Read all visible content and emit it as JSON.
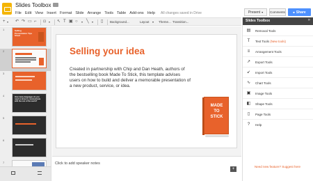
{
  "app": {
    "title": "Slides Toolbox",
    "save_status": "All changes saved in Drive",
    "menu": [
      "File",
      "Edit",
      "View",
      "Insert",
      "Format",
      "Slide",
      "Arrange",
      "Tools",
      "Table",
      "Add-ons",
      "Help"
    ]
  },
  "header_buttons": {
    "present": "Present",
    "comments": "Comments",
    "share": "Share"
  },
  "toolbar": {
    "background": "Background...",
    "layout": "Layout",
    "theme": "Theme...",
    "transition": "Transition..."
  },
  "thumbnails": [
    {
      "num": "1",
      "text": "Selling Presentation Tips Sheet",
      "style": "orange"
    },
    {
      "num": "2",
      "text": "",
      "style": "light"
    },
    {
      "num": "3",
      "text": "",
      "style": "orange"
    },
    {
      "num": "4",
      "text": "How many languages do you need to know to communicate with the rest of the world?",
      "style": "dark"
    },
    {
      "num": "5",
      "text": "",
      "style": "dark"
    },
    {
      "num": "6",
      "text": "",
      "style": "dark"
    },
    {
      "num": "7",
      "text": "",
      "style": "light"
    }
  ],
  "slide": {
    "title": "Selling your idea",
    "body": "Created in partnership with Chip and Dan Heath, authors of the bestselling book Made To Stick, this template advises users on how to build and deliver a memorable presentation of a new product, service, or idea.",
    "book_lines": [
      "MADE",
      "TO",
      "STICK"
    ]
  },
  "notes": {
    "placeholder": "Click to add speaker notes"
  },
  "sidebar": {
    "title": "Slides Toolbox",
    "items": [
      {
        "label": "Removal Tools",
        "icon": "remove-icon"
      },
      {
        "label": "Text Tools",
        "badge": "(New tools)",
        "icon": "text-icon"
      },
      {
        "label": "Arrangement Tools",
        "icon": "arrange-icon"
      },
      {
        "label": "Export Tools",
        "icon": "export-icon"
      },
      {
        "label": "Import Tools",
        "icon": "import-icon"
      },
      {
        "label": "Chart Tools",
        "icon": "chart-icon"
      },
      {
        "label": "Image Tools",
        "icon": "image-icon"
      },
      {
        "label": "Shape Tools",
        "icon": "shape-icon"
      },
      {
        "label": "Page Tools",
        "icon": "page-icon"
      },
      {
        "label": "Help",
        "icon": "help-icon"
      }
    ],
    "feedback": "Need new feature? Suggest here"
  },
  "colors": {
    "accent": "#e8622b",
    "share": "#4d90fe",
    "sidebar_header": "#444444"
  }
}
